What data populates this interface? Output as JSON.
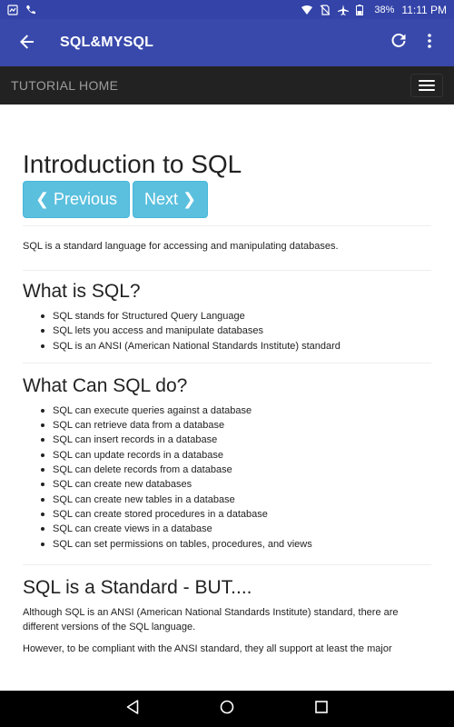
{
  "status_bar": {
    "battery": "38%",
    "time": "11:11 PM"
  },
  "app_bar": {
    "title": "SQL&MYSQL",
    "back_icon": "arrow-back-icon",
    "refresh_icon": "refresh-icon",
    "more_icon": "more-vert-icon"
  },
  "site_nav": {
    "brand": "TUTORIAL HOME",
    "toggle_icon": "hamburger-icon"
  },
  "content": {
    "title": "Introduction to SQL",
    "prev_label": "❮ Previous",
    "next_label": "Next ❯",
    "intro": "SQL is a standard language for accessing and manipulating databases.",
    "section1": {
      "heading": "What is SQL?",
      "items": [
        "SQL stands for Structured Query Language",
        "SQL lets you access and manipulate databases",
        "SQL is an ANSI (American National Standards Institute) standard"
      ]
    },
    "section2": {
      "heading": "What Can SQL do?",
      "items": [
        "SQL can execute queries against a database",
        "SQL can retrieve data from a database",
        "SQL can insert records in a database",
        "SQL can update records in a database",
        "SQL can delete records from a database",
        "SQL can create new databases",
        "SQL can create new tables in a database",
        "SQL can create stored procedures in a database",
        "SQL can create views in a database",
        "SQL can set permissions on tables, procedures, and views"
      ]
    },
    "section3": {
      "heading": "SQL is a Standard - BUT....",
      "para1": "Although SQL is an ANSI (American National Standards Institute) standard, there are different versions of the SQL language.",
      "para2": "However, to be compliant with the ANSI standard, they all support at least the major"
    }
  },
  "nav_bar": {
    "back_icon": "nav-back-icon",
    "home_icon": "nav-home-icon",
    "recents_icon": "nav-recents-icon"
  }
}
